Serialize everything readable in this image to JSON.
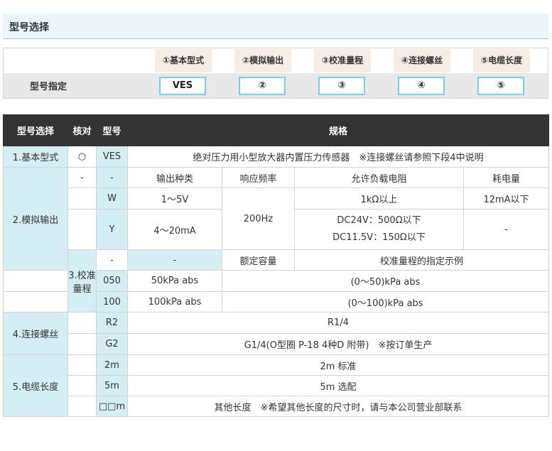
{
  "page_title": "型号选择",
  "model": {
    "label": "型号指定",
    "slots": [
      {
        "heading": "①基本型式",
        "value": "VES"
      },
      {
        "heading": "②模拟输出",
        "value": "②"
      },
      {
        "heading": "③校准量程",
        "value": "③"
      },
      {
        "heading": "④连接螺丝",
        "value": "④"
      },
      {
        "heading": "⑤电缆长度",
        "value": "⑤"
      }
    ]
  },
  "table": {
    "headers": {
      "select": "型号选择",
      "check": "核对",
      "model": "型号",
      "spec": "规格"
    },
    "s1": {
      "name": "1.基本型式",
      "check": "○",
      "code": "VES",
      "spec": "绝对压力用小型放大器内置压力传感器　※连接螺丝请参照下段4中说明"
    },
    "s2": {
      "name": "2.模拟输出",
      "dash1": "-",
      "dash2": "-",
      "h_output": "输出种类",
      "h_freq": "响应频率",
      "h_load": "允许负载电阻",
      "h_power": "耗电量",
      "w_code": "W",
      "w_output": "1～5V",
      "freq": "200Hz",
      "w_load": "1kΩ以上",
      "w_power": "12mA以下",
      "y_code": "Y",
      "y_output": "4～20mA",
      "y_load_1": "DC24V：500Ω以下",
      "y_load_2": "DC11.5V：150Ω以下",
      "y_power": "-"
    },
    "s3": {
      "name": "3.校准量程",
      "dash1": "-",
      "dash2": "-",
      "h_capacity": "额定容量",
      "h_example": "校准量程的指定示例",
      "r1_code": "050",
      "r1_capacity": "50kPa abs",
      "r1_example": "(0～50)kPa abs",
      "r2_code": "100",
      "r2_capacity": "100kPa abs",
      "r2_example": "(0～100)kPa abs"
    },
    "s4": {
      "name": "4.连接螺丝",
      "r1_code": "R2",
      "r1_spec": "R1/4",
      "r2_code": "G2",
      "r2_spec": "G1/4(O型圈 P-18 4种D 附带)　※按订单生产"
    },
    "s5": {
      "name": "5.电缆长度",
      "r1_code": "2m",
      "r1_spec": "2m 标准",
      "r2_code": "5m",
      "r2_spec": "5m 选配",
      "r3_code": "□□m",
      "r3_spec": "其他长度　※希望其他长度的尺寸时，请与本公司营业部联系"
    }
  }
}
